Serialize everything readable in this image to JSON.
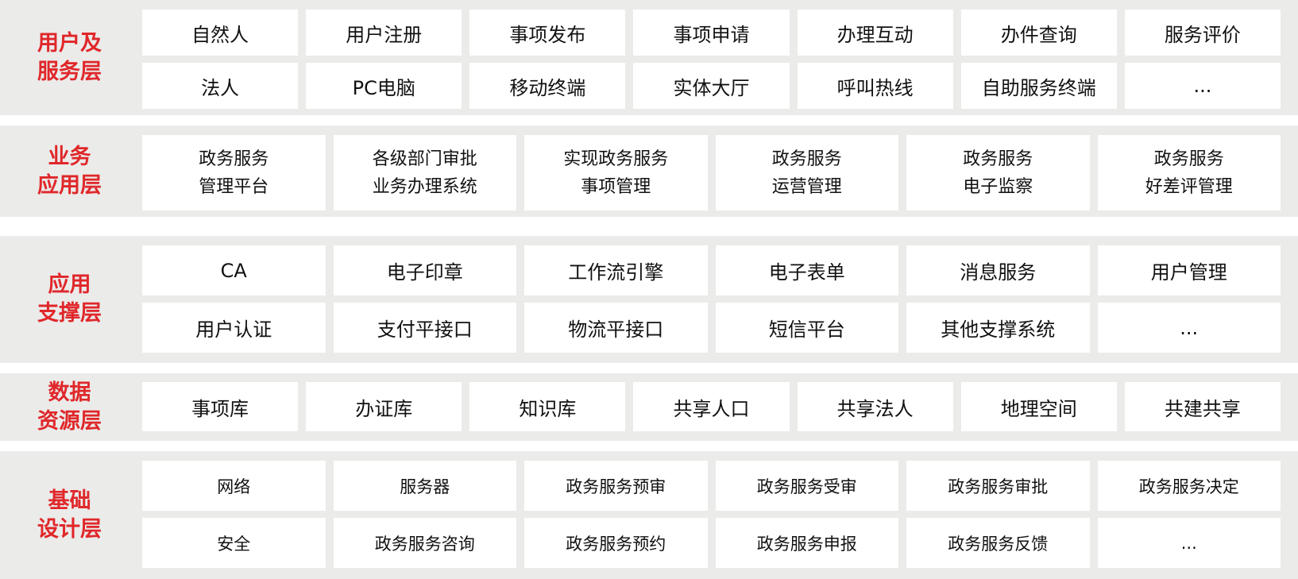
{
  "accent_color": "#e0272a",
  "layers": [
    {
      "label": "用户及\n服务层",
      "rows": [
        [
          "自然人",
          "用户注册",
          "事项发布",
          "事项申请",
          "办理互动",
          "办件查询",
          "服务评价"
        ],
        [
          "法人",
          "PC电脑",
          "移动终端",
          "实体大厅",
          "呼叫热线",
          "自助服务终端",
          "..."
        ]
      ]
    },
    {
      "label": "业务\n应用层",
      "rows": [
        [
          "政务服务\n管理平台",
          "各级部门审批\n业务办理系统",
          "实现政务服务\n事项管理",
          "政务服务\n运营管理",
          "政务服务\n电子监察",
          "政务服务\n好差评管理"
        ]
      ]
    },
    {
      "label": "应用\n支撑层",
      "rows": [
        [
          "CA",
          "电子印章",
          "工作流引擎",
          "电子表单",
          "消息服务",
          "用户管理"
        ],
        [
          "用户认证",
          "支付平接口",
          "物流平接口",
          "短信平台",
          "其他支撑系统",
          "..."
        ]
      ]
    },
    {
      "label": "数据\n资源层",
      "rows": [
        [
          "事项库",
          "办证库",
          "知识库",
          "共享人口",
          "共享法人",
          "地理空间",
          "共建共享"
        ]
      ]
    },
    {
      "label": "基础\n设计层",
      "rows": [
        [
          "网络",
          "服务器",
          "政务服务预审",
          "政务服务受审",
          "政务服务审批",
          "政务服务决定"
        ],
        [
          "安全",
          "政务服务咨询",
          "政务服务预约",
          "政务服务申报",
          "政务服务反馈",
          "..."
        ]
      ]
    }
  ]
}
